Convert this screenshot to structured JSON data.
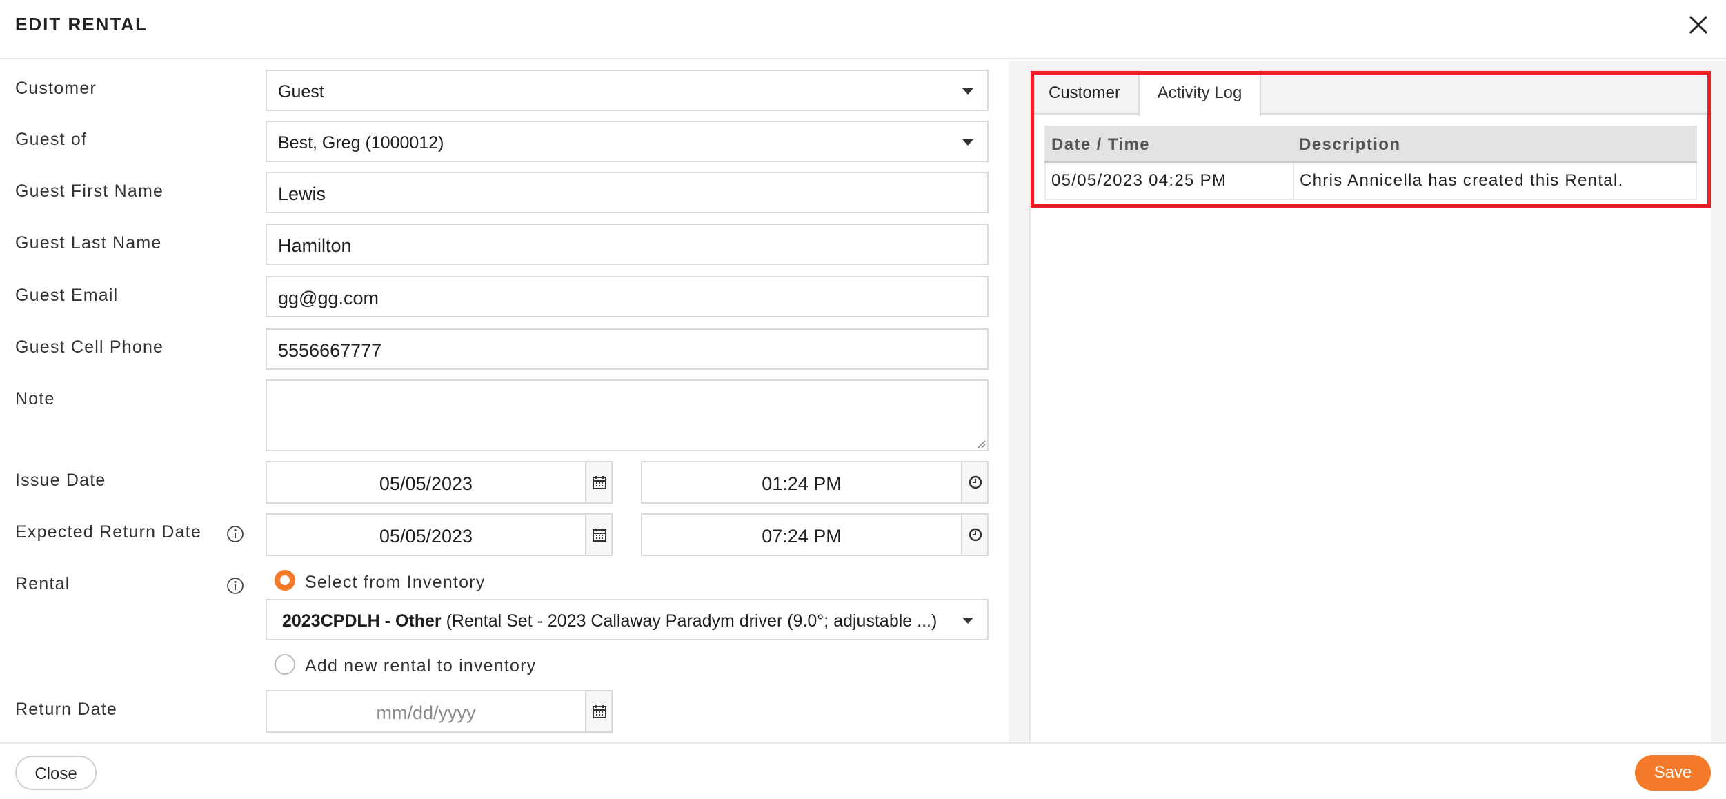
{
  "header": {
    "title": "EDIT RENTAL"
  },
  "form": {
    "customer_label": "Customer",
    "customer_value": "Guest",
    "guest_of_label": "Guest of",
    "guest_of_value": "Best, Greg (1000012)",
    "first_name_label": "Guest First Name",
    "first_name_value": "Lewis",
    "last_name_label": "Guest Last Name",
    "last_name_value": "Hamilton",
    "email_label": "Guest Email",
    "email_value": "gg@gg.com",
    "phone_label": "Guest Cell Phone",
    "phone_value": "5556667777",
    "note_label": "Note",
    "note_value": "",
    "issue_date_label": "Issue Date",
    "issue_date": "05/05/2023",
    "issue_time": "01:24 PM",
    "expected_return_label": "Expected Return Date",
    "expected_return_date": "05/05/2023",
    "expected_return_time": "07:24 PM",
    "rental_label": "Rental",
    "rental_option_inventory": "Select from Inventory",
    "rental_option_inventory_selected": true,
    "rental_item_code": "2023CPDLH - Other",
    "rental_item_desc": "(Rental Set - 2023 Callaway Paradym driver (9.0°; adjustable ...)",
    "rental_option_new": "Add new rental to inventory",
    "return_date_label": "Return Date",
    "return_date_placeholder": "mm/dd/yyyy"
  },
  "panel": {
    "tabs": [
      "Customer",
      "Activity Log"
    ],
    "active_tab": "Activity Log",
    "columns": [
      "Date / Time",
      "Description"
    ],
    "rows": [
      {
        "datetime": "05/05/2023 04:25 PM",
        "description": "Chris Annicella has created this Rental."
      }
    ]
  },
  "footer": {
    "close_label": "Close",
    "save_label": "Save"
  },
  "colors": {
    "accent": "#f47a2a",
    "highlight": "#ee1c25"
  },
  "icons": [
    "close-icon",
    "calendar-icon",
    "clock-icon",
    "info-icon",
    "chevron-down-icon"
  ]
}
